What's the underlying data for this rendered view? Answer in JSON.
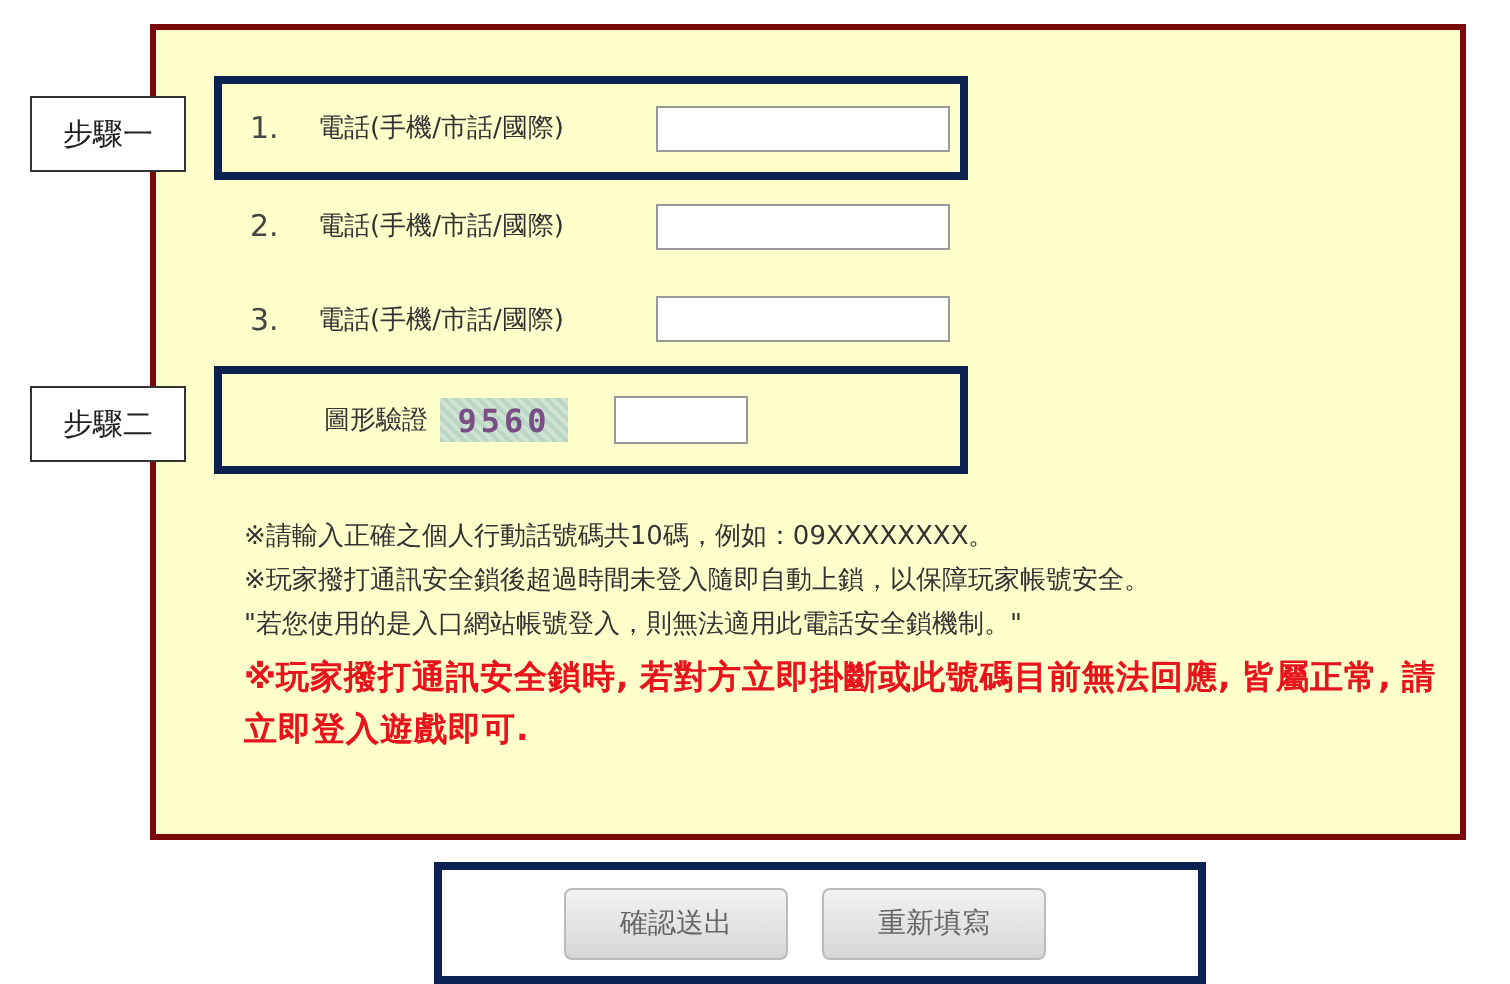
{
  "phones": [
    {
      "number": "1.",
      "label": "電話(手機/市話/國際)",
      "highlighted": true,
      "step": "步驟一"
    },
    {
      "number": "2.",
      "label": "電話(手機/市話/國際)",
      "highlighted": false
    },
    {
      "number": "3.",
      "label": "電話(手機/市話/國際)",
      "highlighted": false
    }
  ],
  "captcha": {
    "label": "圖形驗證",
    "code": "9560",
    "highlighted": true,
    "step": "步驟二"
  },
  "notes": [
    {
      "kind": "normal",
      "text": "※請輸入正確之個人行動話號碼共10碼，例如：09XXXXXXXX。"
    },
    {
      "kind": "normal",
      "text": "※玩家撥打通訊安全鎖後超過時間未登入隨即自動上鎖，以保障玩家帳號安全。"
    },
    {
      "kind": "normal",
      "text": "\"若您使用的是入口網站帳號登入，則無法適用此電話安全鎖機制。\""
    },
    {
      "kind": "warning",
      "text": "※玩家撥打通訊安全鎖時, 若對方立即掛斷或此號碼目前無法回應, 皆屬正常, 請立即登入遊戲即可."
    }
  ],
  "buttons": [
    "確認送出",
    "重新填寫"
  ],
  "buttons_highlighted": true
}
